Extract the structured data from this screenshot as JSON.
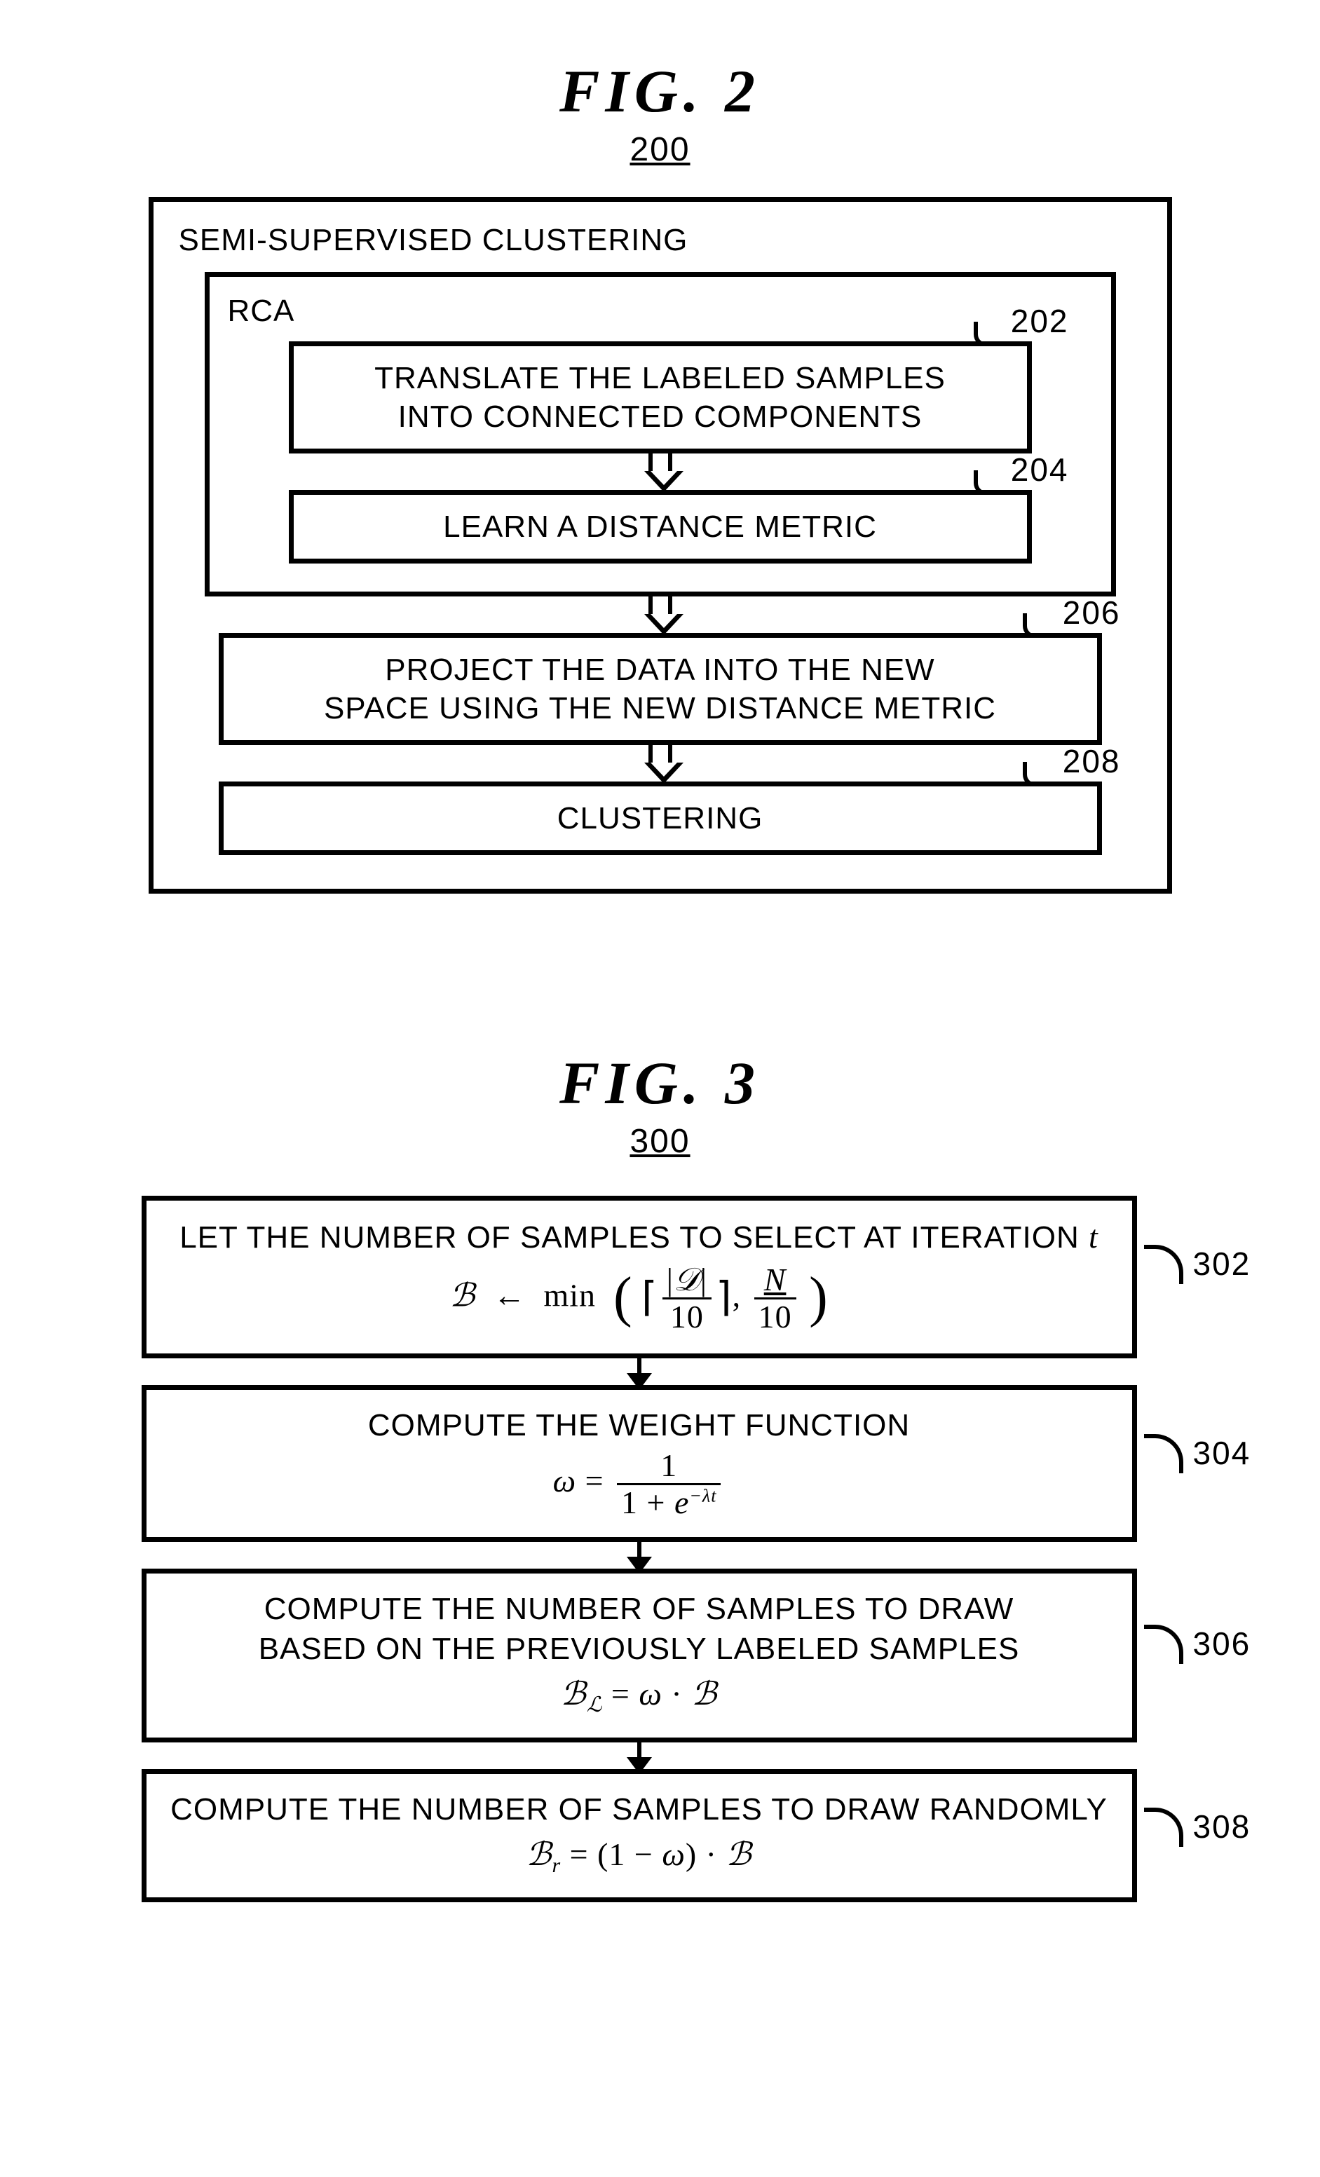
{
  "fig2": {
    "title": "FIG.  2",
    "number": "200",
    "outer_title": "SEMI-SUPERVISED CLUSTERING",
    "rca_title": "RCA",
    "steps": {
      "s202": {
        "ref": "202",
        "text": "TRANSLATE THE LABELED SAMPLES\nINTO CONNECTED COMPONENTS"
      },
      "s204": {
        "ref": "204",
        "text": "LEARN A DISTANCE METRIC"
      },
      "s206": {
        "ref": "206",
        "text": "PROJECT THE DATA INTO THE NEW\nSPACE USING THE NEW DISTANCE METRIC"
      },
      "s208": {
        "ref": "208",
        "text": "CLUSTERING"
      }
    }
  },
  "fig3": {
    "title": "FIG.  3",
    "number": "300",
    "steps": {
      "s302": {
        "ref": "302",
        "line1": "LET THE NUMBER OF SAMPLES TO SELECT AT ITERATION ",
        "var_t": "t",
        "formula": {
          "lhs": "B",
          "op": "←",
          "fn": "min",
          "arg1_num": "|𝒟|",
          "arg1_den": "10",
          "arg2_num": "N",
          "arg2_den": "10"
        }
      },
      "s304": {
        "ref": "304",
        "line1": "COMPUTE THE WEIGHT FUNCTION",
        "formula": {
          "lhs": "ω",
          "eq": "=",
          "num": "1",
          "den_pre": "1 + ",
          "den_e": "e",
          "den_exp": "−λt"
        }
      },
      "s306": {
        "ref": "306",
        "line1": "COMPUTE THE NUMBER OF SAMPLES TO DRAW",
        "line2": "BASED ON THE PREVIOUSLY LABELED SAMPLES",
        "formula": {
          "lhs": "B",
          "sub": "L",
          "eq": " = ",
          "rhs": "ω · B"
        }
      },
      "s308": {
        "ref": "308",
        "line1": "COMPUTE THE NUMBER OF SAMPLES TO DRAW RANDOMLY",
        "formula": {
          "lhs": "B",
          "sub": "r",
          "eq": " = ",
          "rhs": "(1 − ω) · B"
        }
      }
    }
  },
  "chart_data": {
    "type": "diagram",
    "figures": [
      {
        "id": "200",
        "title": "FIG. 2",
        "container": "SEMI-SUPERVISED CLUSTERING",
        "subcontainer": "RCA",
        "flow": [
          {
            "ref": "202",
            "label": "TRANSLATE THE LABELED SAMPLES INTO CONNECTED COMPONENTS",
            "in": "RCA"
          },
          {
            "ref": "204",
            "label": "LEARN A DISTANCE METRIC",
            "in": "RCA"
          },
          {
            "ref": "206",
            "label": "PROJECT THE DATA INTO THE NEW SPACE USING THE NEW DISTANCE METRIC"
          },
          {
            "ref": "208",
            "label": "CLUSTERING"
          }
        ],
        "edges": [
          [
            "202",
            "204"
          ],
          [
            "204",
            "206"
          ],
          [
            "206",
            "208"
          ]
        ]
      },
      {
        "id": "300",
        "title": "FIG. 3",
        "flow": [
          {
            "ref": "302",
            "label": "LET THE NUMBER OF SAMPLES TO SELECT AT ITERATION t;  B ← min(⌈|D|/10⌉, N/10)"
          },
          {
            "ref": "304",
            "label": "COMPUTE THE WEIGHT FUNCTION  ω = 1 / (1 + e^{−λt})"
          },
          {
            "ref": "306",
            "label": "COMPUTE THE NUMBER OF SAMPLES TO DRAW BASED ON THE PREVIOUSLY LABELED SAMPLES  B_L = ω · B"
          },
          {
            "ref": "308",
            "label": "COMPUTE THE NUMBER OF SAMPLES TO DRAW RANDOMLY  B_r = (1 − ω) · B"
          }
        ],
        "edges": [
          [
            "302",
            "304"
          ],
          [
            "304",
            "306"
          ],
          [
            "306",
            "308"
          ]
        ]
      }
    ]
  }
}
